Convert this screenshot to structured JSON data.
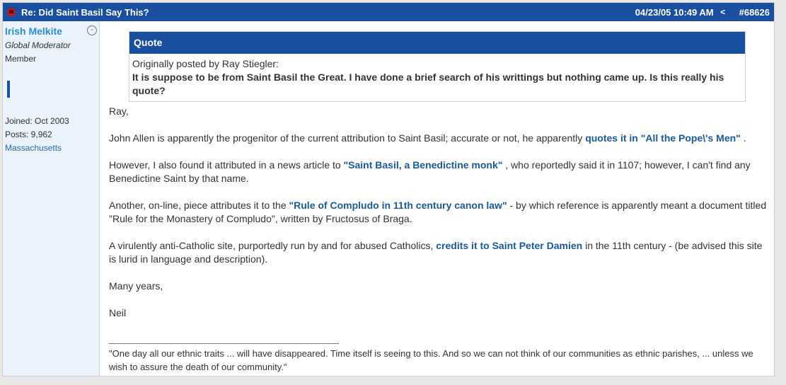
{
  "post": {
    "title": "Re: Did Saint Basil Say This?",
    "date": "04/23/05 10:49 AM",
    "post_number": "#68626",
    "share_icon": "<",
    "status_icon": "-"
  },
  "user": {
    "name": "Irish Melkite",
    "title": "Global Moderator",
    "rank": "Member",
    "joined": "Joined: Oct 2003",
    "posts": "Posts: 9,962",
    "location": "Massachusetts"
  },
  "quote": {
    "label": "Quote",
    "attribution": "Originally posted by Ray Stiegler:",
    "text": "It is suppose to be from Saint Basil the Great. I have done a brief search of his writtings but nothing came up. Is this really his quote?"
  },
  "message": {
    "greeting": "Ray,",
    "p1_text": "John Allen is apparently the progenitor of the current attribution to Saint Basil; accurate or not, he apparently ",
    "p1_link": "quotes it in \"All the Pope\\'s Men\"",
    "p1_end": " .",
    "p2_text": "However, I also found it attributed in a news article to ",
    "p2_link": "\"Saint Basil, a Benedictine monk\"",
    "p2_end": " , who reportedly said it in 1107; however, I can't find any Benedictine Saint by that name.",
    "p3_text": "Another, on-line, piece attributes it to the ",
    "p3_link": "\"Rule of Compludo in 11th century canon law\"",
    "p3_end": " - by which reference is apparently meant a document titled \"Rule for the Monastery of Compludo\", written by Fructosus of Braga.",
    "p4_text": "A virulently anti-Catholic site, purportedly run by and for abused Catholics, ",
    "p4_link": "credits it to Saint Peter Damien",
    "p4_end": " in the 11th century - (be advised this site is lurid in language and description).",
    "closing": "Many years,",
    "signoff": "Neil"
  },
  "signature": "\"One day all our ethnic traits ... will have disappeared. Time itself is seeing to this. And so we can not think of our communities as ethnic parishes, ... unless we wish to assure the death of our community.\"",
  "colors": {
    "header": "#1a4fa0",
    "sidebar": "#eaf2fb",
    "link": "#1a5a9a",
    "username": "#2a8fd3"
  }
}
